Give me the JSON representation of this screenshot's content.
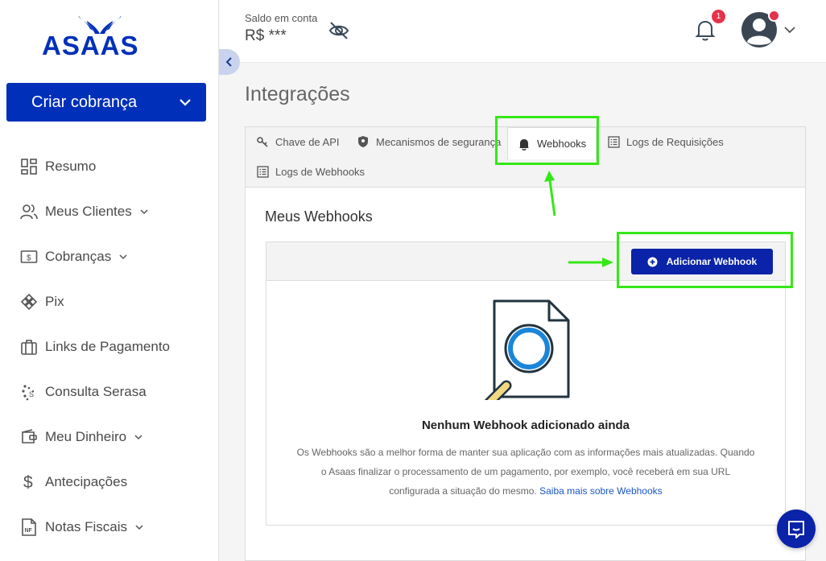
{
  "brand": {
    "logo_text": "ASAAS",
    "primary_color": "#0030b9",
    "annotation_color": "#34e816"
  },
  "sidebar": {
    "create_button": {
      "label": "Criar cobrança",
      "icon": "chevron-down-icon"
    },
    "items": [
      {
        "label": "Resumo",
        "icon": "dashboard-grid-icon",
        "expandable": false
      },
      {
        "label": "Meus Clientes",
        "icon": "users-icon",
        "expandable": true
      },
      {
        "label": "Cobranças",
        "icon": "banknote-icon",
        "expandable": true
      },
      {
        "label": "Pix",
        "icon": "pix-icon",
        "expandable": false
      },
      {
        "label": "Links de Pagamento",
        "icon": "briefcase-icon",
        "expandable": false
      },
      {
        "label": "Consulta Serasa",
        "icon": "serasa-dots-icon",
        "expandable": false
      },
      {
        "label": "Meu Dinheiro",
        "icon": "wallet-icon",
        "expandable": true
      },
      {
        "label": "Antecipações",
        "icon": "dollar-icon",
        "expandable": false
      },
      {
        "label": "Notas Fiscais",
        "icon": "invoice-nf-icon",
        "expandable": true
      }
    ]
  },
  "topbar": {
    "balance_label": "Saldo em conta",
    "balance_value": "R$ ***",
    "notification_count": "1"
  },
  "page": {
    "title": "Integrações",
    "tabs": [
      {
        "label": "Chave de API",
        "icon": "key-icon"
      },
      {
        "label": "Mecanismos de segurança",
        "icon": "shield-icon"
      },
      {
        "label": "Webhooks",
        "icon": "bell-icon",
        "active": true
      },
      {
        "label": "Logs de Requisições",
        "icon": "list-icon"
      },
      {
        "label": "Logs de Webhooks",
        "icon": "list-icon"
      }
    ],
    "section_title": "Meus Webhooks",
    "add_button": "Adicionar Webhook",
    "empty": {
      "title": "Nenhum Webhook adicionado ainda",
      "line1": "Os Webhooks são a melhor forma de manter sua aplicação com as informações mais atualizadas. Quando",
      "line2": "o Asaas finalizar o processamento de um pagamento, por exemplo, você receberá em sua URL",
      "line3_prefix": "configurada a situação do mesmo.",
      "link": "Saiba mais sobre Webhooks"
    }
  }
}
